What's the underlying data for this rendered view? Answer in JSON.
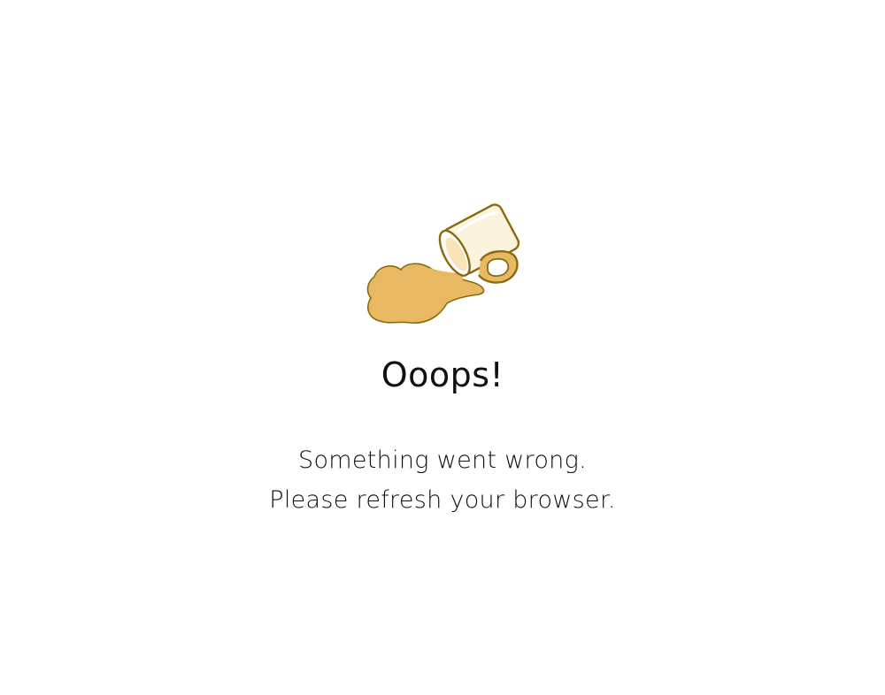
{
  "error": {
    "title": "Ooops!",
    "message_line1": "Something went wrong.",
    "message_line2": "Please refresh your browser."
  },
  "illustration": {
    "icon": "spilled-coffee-cup-icon",
    "outline_color": "#8a6a10",
    "spill_color": "#e8b862",
    "cup_fill": "#fbf3de"
  }
}
